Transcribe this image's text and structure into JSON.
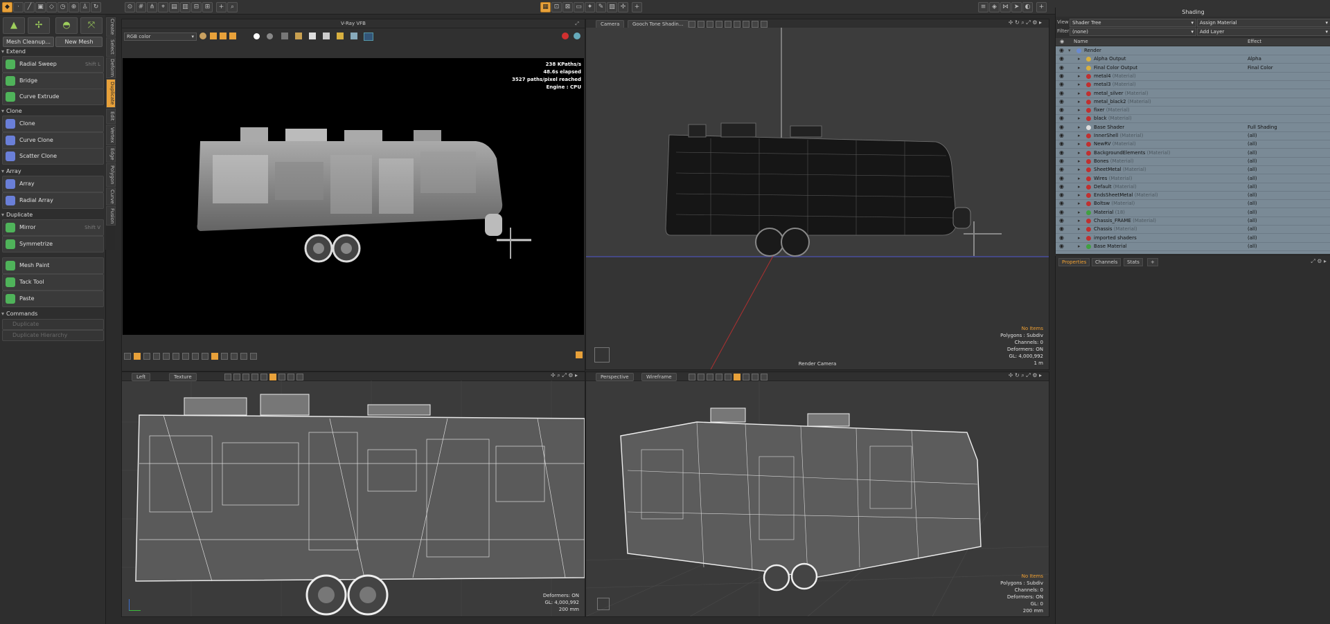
{
  "left_panel": {
    "buttons": {
      "mesh_cleanup": "Mesh Cleanup...",
      "new_mesh": "New Mesh"
    },
    "sections": [
      {
        "title": "Extend",
        "tools": [
          {
            "label": "Radial Sweep",
            "shortcut": "Shift L",
            "color": "#4fb35a"
          },
          {
            "label": "Bridge",
            "shortcut": "",
            "color": "#4fb35a"
          },
          {
            "label": "Curve Extrude",
            "shortcut": "",
            "color": "#4fb35a"
          }
        ]
      },
      {
        "title": "Clone",
        "tools": [
          {
            "label": "Clone",
            "shortcut": "",
            "color": "#6a7fd8"
          },
          {
            "label": "Curve Clone",
            "shortcut": "",
            "color": "#6a7fd8"
          },
          {
            "label": "Scatter Clone",
            "shortcut": "",
            "color": "#6a7fd8"
          }
        ]
      },
      {
        "title": "Array",
        "tools": [
          {
            "label": "Array",
            "shortcut": "",
            "color": "#6a7fd8"
          },
          {
            "label": "Radial Array",
            "shortcut": "",
            "color": "#6a7fd8"
          }
        ]
      },
      {
        "title": "Duplicate",
        "tools": [
          {
            "label": "Mirror",
            "shortcut": "Shift V",
            "color": "#4fb35a"
          },
          {
            "label": "Symmetrize",
            "shortcut": "",
            "color": "#4fb35a"
          }
        ]
      },
      {
        "title": "",
        "tools": [
          {
            "label": "Mesh Paint",
            "shortcut": "",
            "color": "#4fb35a"
          },
          {
            "label": "Tack Tool",
            "shortcut": "",
            "color": "#4fb35a"
          },
          {
            "label": "Paste",
            "shortcut": "",
            "color": "#4fb35a"
          }
        ]
      },
      {
        "title": "Commands",
        "tools": [
          {
            "label": "Duplicate",
            "shortcut": "",
            "color": "#555555"
          },
          {
            "label": "Duplicate Hierarchy",
            "shortcut": "",
            "color": "#555555"
          }
        ]
      }
    ],
    "side_tabs": [
      "Create",
      "Select",
      "Deform",
      "Duplicate",
      "Edit",
      "Vertex",
      "Edge",
      "Polygon",
      "Curve",
      "Fusion"
    ]
  },
  "vray": {
    "title": "V-Ray VFB",
    "channel": "RGB color",
    "stats": [
      "238 KPaths/s",
      "48.6s elapsed",
      "3527 paths/pixel reached",
      "Engine : CPU"
    ]
  },
  "camera_vp": {
    "tab1": "Camera",
    "tab2": "Gooch Tone Shadin...",
    "stats": [
      "No Items",
      "Polygons : Subdiv",
      "Channels: 0",
      "Deformers: ON",
      "GL: 4,000,992",
      "1 m"
    ],
    "camera_label": "Render Camera"
  },
  "left_vp": {
    "tab1": "Left",
    "tab2": "Texture",
    "stats": [
      "Deformers: ON",
      "GL: 4,000,992",
      "200 mm"
    ]
  },
  "persp_vp": {
    "tab1": "Perspective",
    "tab2": "Wireframe",
    "stats": [
      "No Items",
      "Polygons : Subdiv",
      "Channels: 0",
      "Deformers: ON",
      "GL: 0",
      "200 mm"
    ]
  },
  "shading": {
    "title": "Shading",
    "view_label": "View",
    "view_value": "Shader Tree",
    "assign": "Assign Material",
    "filter_label": "Filter",
    "filter_value": "(none)",
    "add_layer": "Add Layer",
    "col_name": "Name",
    "col_effect": "Effect",
    "rows": [
      {
        "name": "Render",
        "type": "",
        "effect": "",
        "indent": 0,
        "color": "#6a8ad0"
      },
      {
        "name": "Alpha Output",
        "type": "",
        "effect": "Alpha",
        "indent": 1,
        "color": "#d8b040"
      },
      {
        "name": "Final Color Output",
        "type": "",
        "effect": "Final Color",
        "indent": 1,
        "color": "#d8b040"
      },
      {
        "name": "metal4",
        "type": "(Material)",
        "effect": "",
        "indent": 1,
        "color": "#c03030"
      },
      {
        "name": "metal3",
        "type": "(Material)",
        "effect": "",
        "indent": 1,
        "color": "#c03030"
      },
      {
        "name": "metal_silver",
        "type": "(Material)",
        "effect": "",
        "indent": 1,
        "color": "#c03030"
      },
      {
        "name": "metal_black2",
        "type": "(Material)",
        "effect": "",
        "indent": 1,
        "color": "#c03030"
      },
      {
        "name": "fixer",
        "type": "(Material)",
        "effect": "",
        "indent": 1,
        "color": "#c03030"
      },
      {
        "name": "black",
        "type": "(Material)",
        "effect": "",
        "indent": 1,
        "color": "#c03030"
      },
      {
        "name": "Base Shader",
        "type": "",
        "effect": "Full Shading",
        "indent": 1,
        "color": "#dddddd"
      },
      {
        "name": "InnerShell",
        "type": "(Material)",
        "effect": "(all)",
        "indent": 1,
        "color": "#c03030"
      },
      {
        "name": "NewRV",
        "type": "(Material)",
        "effect": "(all)",
        "indent": 1,
        "color": "#c03030"
      },
      {
        "name": "BackgroundElements",
        "type": "(Material)",
        "effect": "(all)",
        "indent": 1,
        "color": "#c03030"
      },
      {
        "name": "Bones",
        "type": "(Material)",
        "effect": "(all)",
        "indent": 1,
        "color": "#c03030"
      },
      {
        "name": "SheetMetal",
        "type": "(Material)",
        "effect": "(all)",
        "indent": 1,
        "color": "#c03030"
      },
      {
        "name": "Wires",
        "type": "(Material)",
        "effect": "(all)",
        "indent": 1,
        "color": "#c03030"
      },
      {
        "name": "Default",
        "type": "(Material)",
        "effect": "(all)",
        "indent": 1,
        "color": "#c03030"
      },
      {
        "name": "EndsSheetMetal",
        "type": "(Material)",
        "effect": "(all)",
        "indent": 1,
        "color": "#c03030"
      },
      {
        "name": "Boltsw",
        "type": "(Material)",
        "effect": "(all)",
        "indent": 1,
        "color": "#c03030"
      },
      {
        "name": "Material",
        "type": "(18)",
        "effect": "(all)",
        "indent": 1,
        "color": "#40a040"
      },
      {
        "name": "Chassis_FRAME",
        "type": "(Material)",
        "effect": "(all)",
        "indent": 1,
        "color": "#c03030"
      },
      {
        "name": "Chassis",
        "type": "(Material)",
        "effect": "(all)",
        "indent": 1,
        "color": "#c03030"
      },
      {
        "name": "imported shaders",
        "type": "",
        "effect": "(all)",
        "indent": 1,
        "color": "#c03030"
      },
      {
        "name": "Base Material",
        "type": "",
        "effect": "(all)",
        "indent": 1,
        "color": "#40a040"
      }
    ]
  },
  "properties": {
    "tabs": [
      "Properties",
      "Channels",
      "Stats",
      "+"
    ]
  }
}
